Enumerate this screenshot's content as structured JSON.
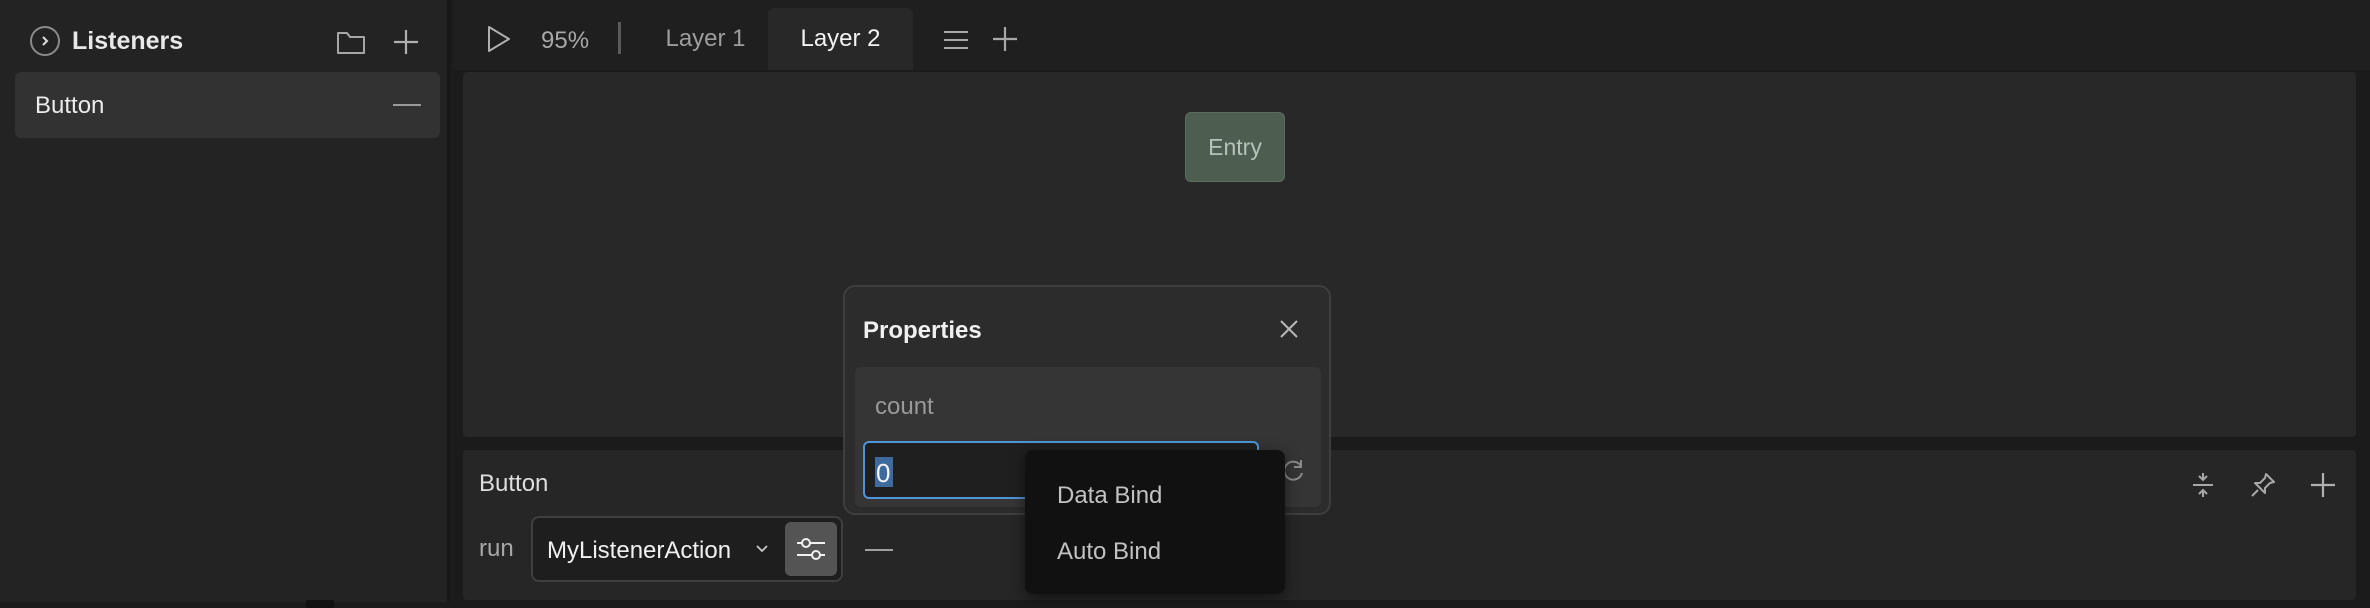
{
  "left_panel": {
    "title": "Listeners",
    "items": [
      {
        "label": "Button"
      }
    ]
  },
  "toolbar": {
    "zoom": "95%",
    "tabs": [
      {
        "label": "Layer 1",
        "active": false
      },
      {
        "label": "Layer 2",
        "active": true
      }
    ]
  },
  "canvas": {
    "entry_node_label": "Entry"
  },
  "listener_panel": {
    "title": "Button",
    "action_keyword": "run",
    "action_selected": "MyListenerAction"
  },
  "properties_popup": {
    "title": "Properties",
    "property_name": "count",
    "property_value": "0"
  },
  "bind_menu": {
    "items": [
      {
        "label": "Data Bind"
      },
      {
        "label": "Auto Bind"
      }
    ]
  },
  "colors": {
    "accent_focus": "#4f93d9",
    "entry_node": "#4d5e50",
    "background": "#1b1b1b"
  },
  "icons": [
    "chevron-right-icon",
    "folder-icon",
    "plus-icon",
    "minus-icon",
    "play-icon",
    "hamburger-menu-icon",
    "close-icon",
    "sliders-icon",
    "pin-icon",
    "expand-icon",
    "refresh-icon",
    "chevron-down-icon"
  ]
}
